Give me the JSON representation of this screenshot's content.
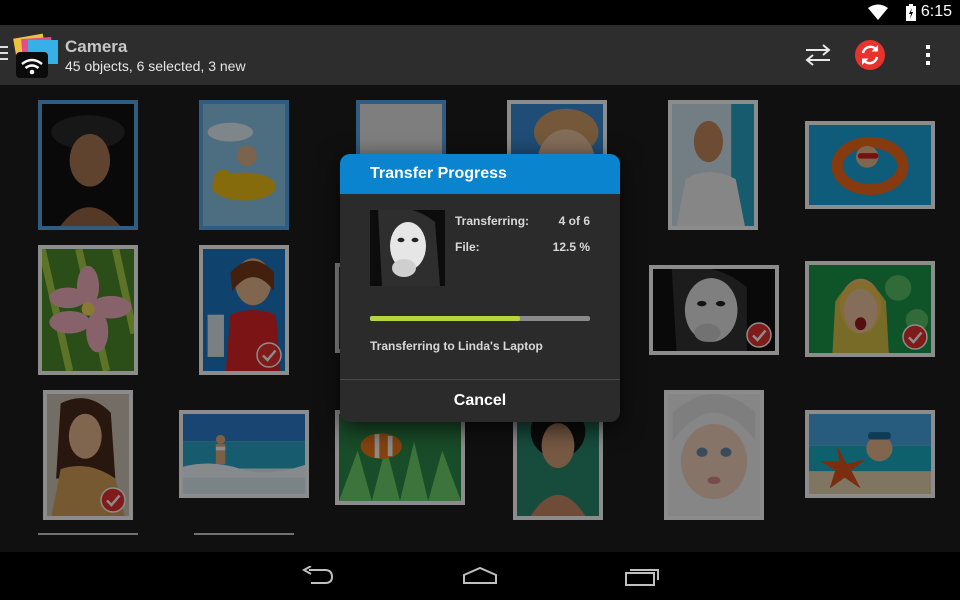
{
  "status_bar": {
    "time": "6:15",
    "icons": [
      "wifi-icon",
      "battery-icon"
    ]
  },
  "action_bar": {
    "title": "Camera",
    "subtitle": "45 objects, 6 selected, 3 new",
    "actions": [
      "transfer-arrows-icon",
      "sync-icon",
      "overflow-menu-icon"
    ]
  },
  "grid": {
    "items": [
      {
        "selected": true,
        "checked": false
      },
      {
        "selected": true,
        "checked": false
      },
      {
        "selected": true,
        "checked": false
      },
      {
        "selected": false,
        "checked": false
      },
      {
        "selected": false,
        "checked": false
      },
      {
        "selected": false,
        "checked": false
      },
      {
        "selected": false,
        "checked": false
      },
      {
        "selected": false,
        "checked": true
      },
      {
        "selected": false,
        "checked": false
      },
      {
        "selected": false,
        "checked": false
      },
      {
        "selected": false,
        "checked": true
      },
      {
        "selected": false,
        "checked": true
      },
      {
        "selected": false,
        "checked": true
      },
      {
        "selected": false,
        "checked": false
      },
      {
        "selected": false,
        "checked": false
      },
      {
        "selected": false,
        "checked": false
      },
      {
        "selected": false,
        "checked": false
      },
      {
        "selected": false,
        "checked": false
      }
    ]
  },
  "dialog": {
    "title": "Transfer Progress",
    "transferring_label": "Transferring:",
    "transferring_value": "4 of 6",
    "file_label": "File:",
    "file_value": "12.5 %",
    "progress": 0.68,
    "status": "Transferring to Linda's Laptop",
    "cancel_label": "Cancel"
  },
  "nav_bar": {
    "buttons": [
      "back-icon",
      "home-icon",
      "recent-apps-icon"
    ]
  },
  "colors": {
    "accent": "#0a84cf",
    "selection": "#5aa7e8",
    "sync": "#e8322d",
    "progress": "#b6d43c"
  }
}
